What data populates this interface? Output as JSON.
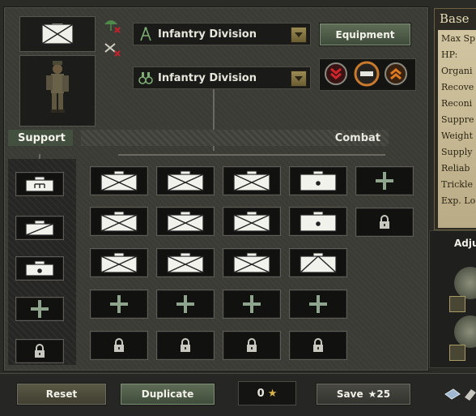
{
  "top": {
    "division_name": "Infantry Division",
    "template_name": "Infantry Division",
    "equipment_label": "Equipment"
  },
  "sections": {
    "support": "Support",
    "combat": "Combat"
  },
  "support_column": [
    {
      "kind": "unit",
      "symbol": "engineer-symbol"
    },
    {
      "kind": "unit",
      "symbol": "recon-symbol"
    },
    {
      "kind": "unit",
      "symbol": "artillery-symbol"
    },
    {
      "kind": "add"
    },
    {
      "kind": "locked"
    }
  ],
  "combat_grid": {
    "columns": [
      [
        "infantry",
        "infantry",
        "infantry",
        "add",
        "locked"
      ],
      [
        "infantry",
        "infantry",
        "infantry",
        "add",
        "locked"
      ],
      [
        "infantry",
        "infantry",
        "infantry",
        "add",
        "locked"
      ],
      [
        "artillery",
        "artillery",
        "anti-tank",
        "add",
        "locked"
      ],
      [
        "add",
        "locked"
      ]
    ]
  },
  "bottom": {
    "reset_label": "Reset",
    "duplicate_label": "Duplicate",
    "cost_value": "0",
    "save_label": "Save",
    "save_cost": "25"
  },
  "stats_panel": {
    "title": "Base",
    "rows": [
      "Max Sp",
      "HP:",
      "Organi",
      "Recove",
      "Reconi",
      "Suppre",
      "Weight",
      "Supply",
      "Reliab",
      "Trickle",
      "Exp. Lo"
    ]
  },
  "adjust_panel": {
    "label": "Adju"
  },
  "colors": {
    "accent_green": "#5f6e57",
    "danger_red": "#b0202a",
    "orange": "#d0701e",
    "parchment": "#c8bc96"
  }
}
